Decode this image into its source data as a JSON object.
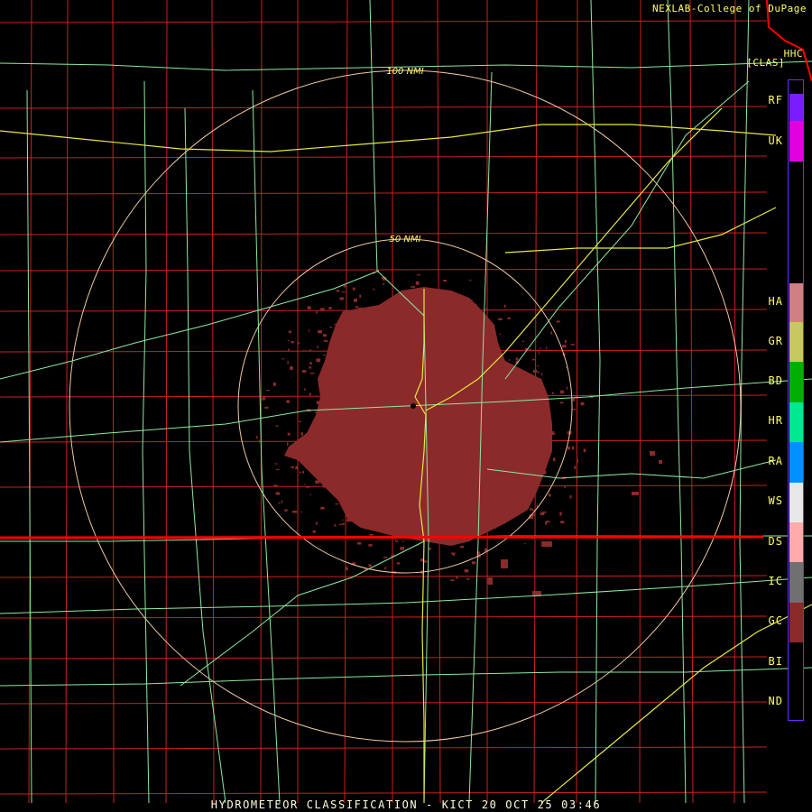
{
  "header": {
    "credit": "NEXLAB-College of DuPage",
    "station_code": "HHC",
    "product_code": "[CLAS]"
  },
  "rings": [
    {
      "label": "100 NMI"
    },
    {
      "label": "50 NMI"
    }
  ],
  "legend": [
    {
      "code": "RF",
      "color": "#7a1cff"
    },
    {
      "code": "UK",
      "color": "#e000e0"
    },
    {
      "code": "HA",
      "color": "#ff0000"
    },
    {
      "code": "GR",
      "color": "#d08080"
    },
    {
      "code": "BD",
      "color": "#c8c860"
    },
    {
      "code": "HR",
      "color": "#00b000"
    },
    {
      "code": "RA",
      "color": "#00e890"
    },
    {
      "code": "WS",
      "color": "#0090ff"
    },
    {
      "code": "DS",
      "color": "#e8e8e8"
    },
    {
      "code": "IC",
      "color": "#ffaaaa"
    },
    {
      "code": "GC",
      "color": "#707070"
    },
    {
      "code": "BI",
      "color": "#8b2828"
    },
    {
      "code": "ND",
      "color": "#000000"
    }
  ],
  "echo_color": "#8b2a2a",
  "colors": {
    "county_lines": "#cc2020",
    "state_line": "#ff0000",
    "highways": "#8fe8a0",
    "interstates": "#e8e840",
    "rings": "#f0c8a0"
  },
  "footer": "HYDROMETEOR CLASSIFICATION - KICT 20 OCT 25 03:46"
}
